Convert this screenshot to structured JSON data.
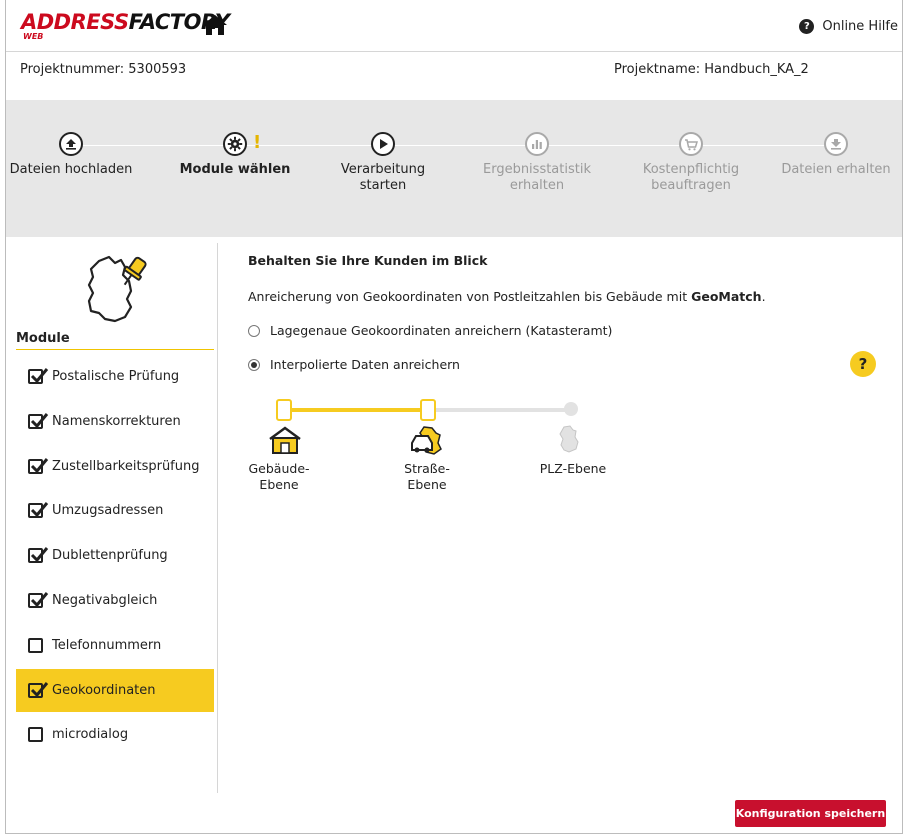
{
  "header": {
    "logo_main_a": "ADDRESS",
    "logo_main_b": "FACTORY",
    "logo_sub": "WEB",
    "help_label": "Online Hilfe"
  },
  "project": {
    "number_label": "Projektnummer: 5300593",
    "name_label": "Projektname: Handbuch_KA_2"
  },
  "steps": [
    {
      "label": "Dateien hochladen",
      "icon": "upload-icon",
      "state": "done"
    },
    {
      "label": "Module wählen",
      "icon": "gear-icon",
      "state": "active"
    },
    {
      "label": "Verarbeitung starten",
      "icon": "play-icon",
      "state": "enabled"
    },
    {
      "label": "Ergebnisstatistik erhalten",
      "icon": "bar-chart-icon",
      "state": "disabled"
    },
    {
      "label": "Kostenpflichtig beauftragen",
      "icon": "cart-icon",
      "state": "disabled"
    },
    {
      "label": "Dateien erhalten",
      "icon": "download-icon",
      "state": "disabled"
    }
  ],
  "step_warning": "!",
  "sidebar": {
    "title": "Module",
    "items": [
      {
        "label": "Postalische Prüfung",
        "checked": true
      },
      {
        "label": "Namenskorrekturen",
        "checked": true
      },
      {
        "label": "Zustellbarkeitsprüfung",
        "checked": true
      },
      {
        "label": "Umzugsadressen",
        "checked": true
      },
      {
        "label": "Dublettenprüfung",
        "checked": true
      },
      {
        "label": "Negativabgleich",
        "checked": true
      },
      {
        "label": "Telefonnummern",
        "checked": false
      },
      {
        "label": "Geokoordinaten",
        "checked": true,
        "selected": true
      },
      {
        "label": "microdialog",
        "checked": false
      }
    ]
  },
  "main": {
    "title": "Behalten Sie Ihre Kunden im Blick",
    "desc_prefix": "Anreicherung von Geokoordinaten von Postleitzahlen bis Gebäude mit ",
    "desc_bold": "GeoMatch",
    "desc_suffix": ".",
    "radio1": "Lagegenaue Geokoordinaten anreichern (Katasteramt)",
    "radio2": "Interpolierte Daten anreichern",
    "radio_selected": 2,
    "hint_symbol": "?",
    "levels": [
      {
        "line1": "Gebäude-",
        "line2": "Ebene"
      },
      {
        "line1": "Straße-",
        "line2": "Ebene"
      },
      {
        "line1": "PLZ-Ebene",
        "line2": ""
      }
    ]
  },
  "save_button": "Konfiguration speichern",
  "colors": {
    "brand_red": "#cc0a1e",
    "accent_yellow": "#f6cb20",
    "stepper_bg": "#e7e7e7"
  }
}
